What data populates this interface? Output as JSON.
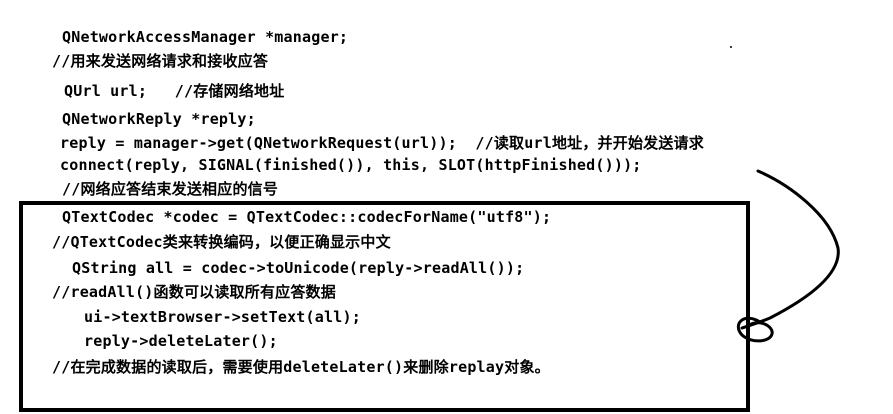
{
  "code": {
    "lines": [
      "QNetworkAccessManager *manager;",
      "//用来发送网络请求和接收应答",
      "QUrl url;   //存储网络地址",
      "QNetworkReply *reply;",
      "reply = manager->get(QNetworkRequest(url));  //读取url地址，并开始发送请求",
      "connect(reply, SIGNAL(finished()), this, SLOT(httpFinished()));",
      "//网络应答结束发送相应的信号",
      "QTextCodec *codec = QTextCodec::codecForName(\"utf8\");",
      "//QTextCodec类来转换编码，以便正确显示中文",
      "QString all = codec->toUnicode(reply->readAll());",
      "//readAll()函数可以读取所有应答数据",
      "ui->textBrowser->setText(all);",
      "reply->deleteLater();",
      "//在完成数据的读取后，需要使用deleteLater()来删除replay对象。"
    ]
  },
  "annotation": {
    "box_color": "#000000",
    "arrow_color": "#000000"
  }
}
